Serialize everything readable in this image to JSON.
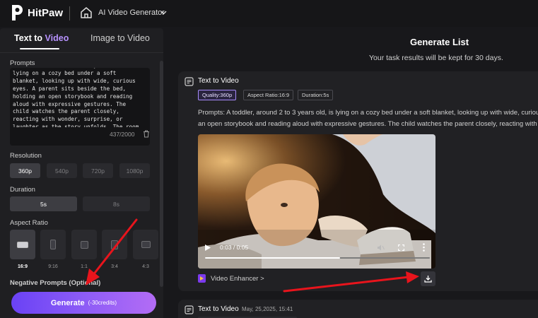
{
  "header": {
    "brand": "HitPaw",
    "nav_title": "AI Video Generator"
  },
  "left_panel": {
    "tabs": [
      {
        "label_main": "Text to ",
        "label_accent": "Video",
        "active": true
      },
      {
        "label": "Image to Video",
        "active": false
      }
    ],
    "prompts_label": "Prompts",
    "prompt_text": "A toddler, around 2 to 3 years old, is lying on a cozy bed under a soft blanket, looking up with wide, curious eyes. A parent sits beside the bed, holding an open storybook and reading aloud with expressive gestures. The child watches the parent closely, reacting with wonder, surprise, or laughter as the story unfolds. The room is softly lit with a warm",
    "prompt_count": "437/2000",
    "resolution_label": "Resolution",
    "resolutions": [
      {
        "label": "360p",
        "selected": true
      },
      {
        "label": "540p",
        "selected": false
      },
      {
        "label": "720p",
        "selected": false
      },
      {
        "label": "1080p",
        "selected": false
      }
    ],
    "duration_label": "Duration",
    "durations": [
      {
        "label": "5s",
        "selected": true
      },
      {
        "label": "8s",
        "selected": false
      }
    ],
    "aspect_label": "Aspect Ratio",
    "aspects": [
      {
        "label": "16:9",
        "selected": true
      },
      {
        "label": "9:16",
        "selected": false
      },
      {
        "label": "1:1",
        "selected": false
      },
      {
        "label": "3:4",
        "selected": false
      },
      {
        "label": "4:3",
        "selected": false
      }
    ],
    "negative_label": "Negative Prompts (Optional)",
    "generate_label": "Generate",
    "generate_credits": "(-30credits)"
  },
  "generate_list": {
    "title": "Generate List",
    "subtitle": "Your task results will be kept for 30 days."
  },
  "task_card": {
    "title": "Text to Video",
    "tags": [
      "Quality:360p",
      "Aspect Ratio:16:9",
      "Duration:5s"
    ],
    "prompt_line1": "Prompts:  A toddler, around 2 to 3 years old, is lying on a cozy bed under a soft blanket, looking up with wide, curious eyes. A parent sits beside the bed, holding",
    "prompt_line2": "an open storybook and reading aloud with expressive gestures. The child watches the parent closely, reacting with wonder, surprise, or laughter",
    "video_time": "0:03 / 0:05",
    "video_progress": 0.6,
    "enhancer_label": "Video Enhancer >"
  },
  "task_card_2": {
    "title": "Text to Video",
    "date": "May, 25,2025, 15:41"
  },
  "colors": {
    "accent": "#b792ff",
    "annotation_arrow": "#e8141c"
  }
}
